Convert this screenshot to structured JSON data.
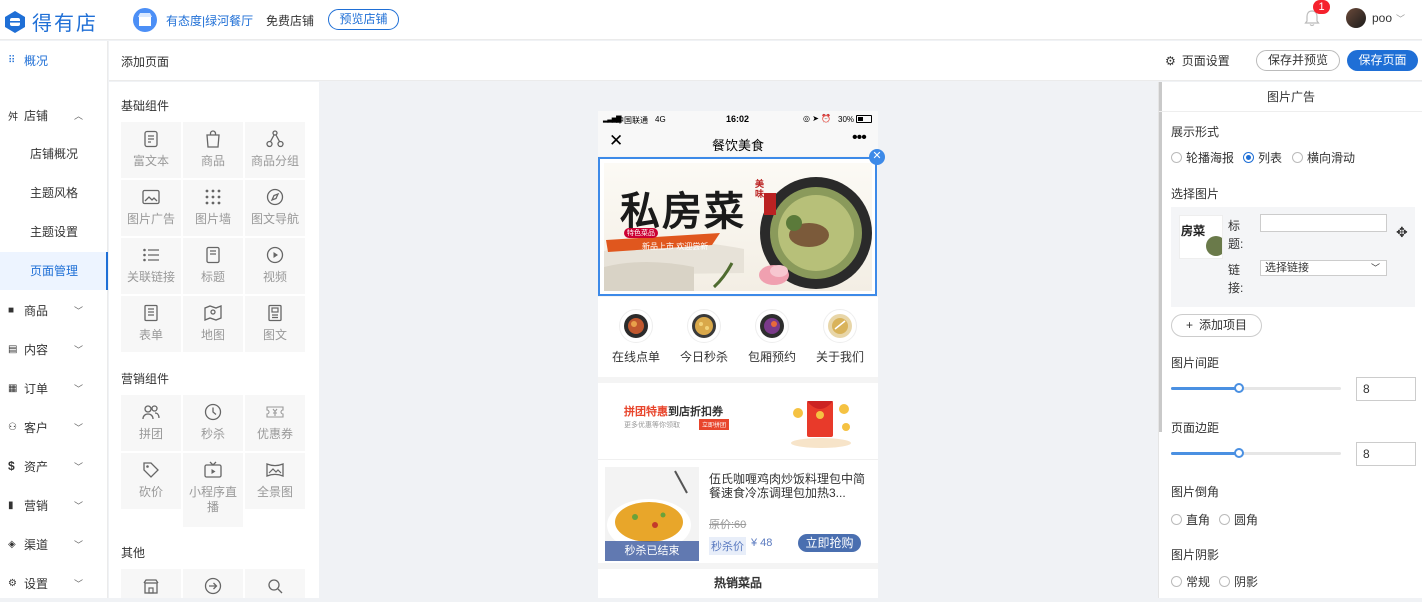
{
  "header": {
    "logo_text": "得有店",
    "store_name": "有态度|绿河餐厅",
    "store_tag": "免费店铺",
    "preview_store": "预览店铺",
    "notif_count": "1",
    "username": "poo"
  },
  "nav": {
    "overview": "概况",
    "shop": "店铺",
    "shop_overview": "店铺概况",
    "theme_style": "主题风格",
    "theme_settings": "主题设置",
    "page_manage": "页面管理",
    "goods": "商品",
    "content": "内容",
    "orders": "订单",
    "customers": "客户",
    "assets": "资产",
    "marketing": "营销",
    "channels": "渠道",
    "settings": "设置"
  },
  "subheader": {
    "title": "添加页面",
    "page_settings": "页面设置",
    "save_preview": "保存并预览",
    "save_page": "保存页面"
  },
  "components": {
    "basic_title": "基础组件",
    "basic": [
      "富文本",
      "商品",
      "商品分组",
      "图片广告",
      "图片墙",
      "图文导航",
      "关联链接",
      "标题",
      "视频",
      "表单",
      "地图",
      "图文"
    ],
    "marketing_title": "营销组件",
    "marketing": [
      "拼团",
      "秒杀",
      "优惠券",
      "砍价",
      "小程序直播",
      "全景图"
    ],
    "other_title": "其他"
  },
  "phone": {
    "carrier": "中国联通",
    "network": "4G",
    "time": "16:02",
    "battery": "30%",
    "page_title": "餐饮美食",
    "banner": {
      "calligraphy": "私房菜",
      "seal": "美味",
      "slogan": "新品上市 欢迎尝新",
      "badge": "特色菜品"
    },
    "icons": [
      "在线点单",
      "今日秒杀",
      "包厢预约",
      "关于我们"
    ],
    "coupon": {
      "title_red": "拼团特惠",
      "title_rest": "到店折扣券",
      "sub": "更多优惠等你领取",
      "tag": "立即拼团"
    },
    "product": {
      "name": "伍氏咖喱鸡肉炒饭料理包中简餐速食冷冻调理包加热3...",
      "orig_price": "原价:60",
      "flash_label": "秒杀价",
      "flash_price": "¥ 48",
      "buy": "立即抢购",
      "ended": "秒杀已结束"
    },
    "hot_title": "热销菜品"
  },
  "panel": {
    "title": "图片广告",
    "display_label": "展示形式",
    "display_options": [
      "轮播海报",
      "列表",
      "横向滑动"
    ],
    "display_selected": "列表",
    "select_image": "选择图片",
    "thumb_text": "房菜",
    "title_label": "标题:",
    "link_label": "链接:",
    "link_select": "选择链接",
    "add_item": "添加项目",
    "spacing_label": "图片间距",
    "spacing_value": "8",
    "spacing_fraction": 0.4,
    "margin_label": "页面边距",
    "margin_value": "8",
    "margin_fraction": 0.4,
    "corner_label": "图片倒角",
    "corner_options": [
      "直角",
      "圆角"
    ],
    "shadow_label": "图片阴影",
    "shadow_options": [
      "常规",
      "阴影"
    ]
  }
}
